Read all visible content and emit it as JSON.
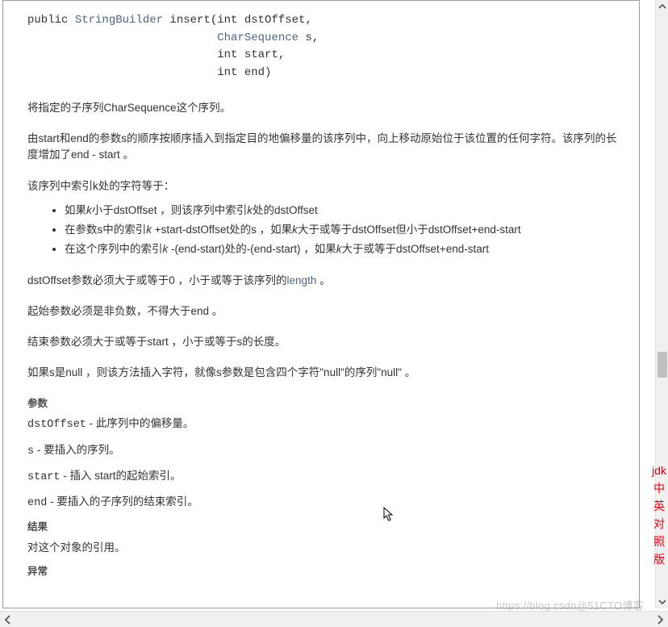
{
  "signature": {
    "line1_pre": "public ",
    "line1_type": "StringBuilder",
    "line1_rest": " insert(int dstOffset,",
    "line2_type": "CharSequence",
    "line2_rest": " s,",
    "line3": "int start,",
    "line4": "int end)"
  },
  "paras": {
    "p1": "将指定的子序列CharSequence这个序列。",
    "p2": "由start和end的参数s的顺序按顺序插入到指定目的地偏移量的该序列中，向上移动原始位于该位置的任何字符。该序列的长度增加了end - start 。",
    "p3": "该序列中索引k处的字符等于：",
    "b1a": "如果",
    "b1b": "k",
    "b1c": "小于dstOffset ，则该序列中索引",
    "b1d": "k",
    "b1e": "处的dstOffset",
    "b2a": "在参数s中的索引",
    "b2b": "k",
    "b2c": " +start-dstOffset处的s ，如果",
    "b2d": "k",
    "b2e": "大于或等于dstOffset但小于dstOffset+end-start",
    "b3a": "在这个序列中的索引",
    "b3b": "k",
    "b3c": " -(end-start)处的-(end-start) ，如果",
    "b3d": "k",
    "b3e": "大于或等于dstOffset+end-start",
    "p4a": "dstOffset参数必须大于或等于0 ，小于或等于该序列的",
    "p4b": "length",
    "p4c": " 。",
    "p5": "起始参数必须是非负数，不得大于end 。",
    "p6": "结束参数必须大于或等于start ，小于或等于s的长度。",
    "p7": "如果s是null ，则该方法插入字符，就像s参数是包含四个字符\"null\"的序列\"null\" 。"
  },
  "params": {
    "heading": "参数",
    "l1a": "dstOffset",
    "l1b": " - 此序列中的偏移量。",
    "l2a": "s",
    "l2b": " - 要插入的序列。",
    "l3a": "start",
    "l3b": " - 插入 start的起始索引。",
    "l4a": "end",
    "l4b": " - 要插入的子序列的结束索引。"
  },
  "result": {
    "heading": "结果",
    "text": "对这个对象的引用。"
  },
  "except": {
    "heading": "异常"
  },
  "side": {
    "c1": "jdk",
    "c2": "中",
    "c3": "英",
    "c4": "对",
    "c5": "照",
    "c6": "版"
  },
  "watermark": "https://blog.csdn@51CTO博客"
}
